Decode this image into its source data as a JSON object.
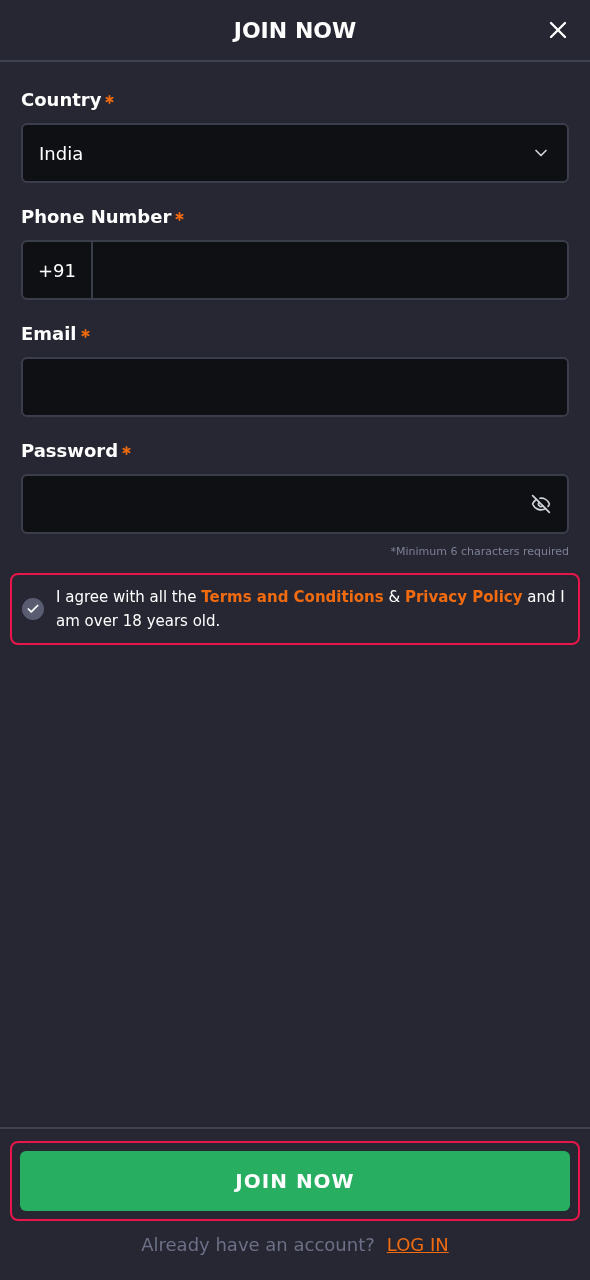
{
  "header": {
    "title": "JOIN NOW"
  },
  "fields": [
    {
      "kind": "select",
      "label": "Country",
      "required": true,
      "value": "India"
    },
    {
      "kind": "phone",
      "label": "Phone Number",
      "required": true,
      "prefix": "+91"
    },
    {
      "kind": "text",
      "label": "Email",
      "required": true
    },
    {
      "kind": "password",
      "label": "Password",
      "required": true,
      "hint": "*Minimum 6 characters required"
    }
  ],
  "agreement": {
    "checked": true,
    "highlighted": true,
    "parts": [
      {
        "kind": "text",
        "text": "I agree with all the "
      },
      {
        "kind": "link",
        "text": "Terms and Conditions"
      },
      {
        "kind": "text",
        "text": " & "
      },
      {
        "kind": "link",
        "text": "Privacy Policy"
      },
      {
        "kind": "text",
        "text": " and I am over 18 years old."
      }
    ]
  },
  "footer": {
    "button": "JOIN NOW",
    "button_highlighted": true,
    "prompt": "Already have an account?",
    "link": "LOG IN"
  }
}
